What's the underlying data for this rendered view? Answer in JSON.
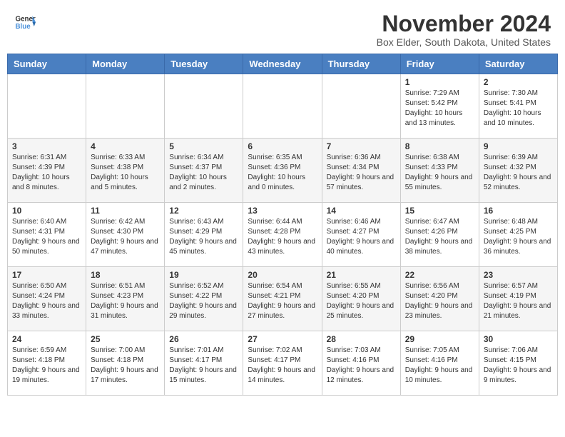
{
  "header": {
    "logo_line1": "General",
    "logo_line2": "Blue",
    "title": "November 2024",
    "subtitle": "Box Elder, South Dakota, United States"
  },
  "days_of_week": [
    "Sunday",
    "Monday",
    "Tuesday",
    "Wednesday",
    "Thursday",
    "Friday",
    "Saturday"
  ],
  "weeks": [
    [
      {
        "day": "",
        "info": ""
      },
      {
        "day": "",
        "info": ""
      },
      {
        "day": "",
        "info": ""
      },
      {
        "day": "",
        "info": ""
      },
      {
        "day": "",
        "info": ""
      },
      {
        "day": "1",
        "info": "Sunrise: 7:29 AM\nSunset: 5:42 PM\nDaylight: 10 hours and 13 minutes."
      },
      {
        "day": "2",
        "info": "Sunrise: 7:30 AM\nSunset: 5:41 PM\nDaylight: 10 hours and 10 minutes."
      }
    ],
    [
      {
        "day": "3",
        "info": "Sunrise: 6:31 AM\nSunset: 4:39 PM\nDaylight: 10 hours and 8 minutes."
      },
      {
        "day": "4",
        "info": "Sunrise: 6:33 AM\nSunset: 4:38 PM\nDaylight: 10 hours and 5 minutes."
      },
      {
        "day": "5",
        "info": "Sunrise: 6:34 AM\nSunset: 4:37 PM\nDaylight: 10 hours and 2 minutes."
      },
      {
        "day": "6",
        "info": "Sunrise: 6:35 AM\nSunset: 4:36 PM\nDaylight: 10 hours and 0 minutes."
      },
      {
        "day": "7",
        "info": "Sunrise: 6:36 AM\nSunset: 4:34 PM\nDaylight: 9 hours and 57 minutes."
      },
      {
        "day": "8",
        "info": "Sunrise: 6:38 AM\nSunset: 4:33 PM\nDaylight: 9 hours and 55 minutes."
      },
      {
        "day": "9",
        "info": "Sunrise: 6:39 AM\nSunset: 4:32 PM\nDaylight: 9 hours and 52 minutes."
      }
    ],
    [
      {
        "day": "10",
        "info": "Sunrise: 6:40 AM\nSunset: 4:31 PM\nDaylight: 9 hours and 50 minutes."
      },
      {
        "day": "11",
        "info": "Sunrise: 6:42 AM\nSunset: 4:30 PM\nDaylight: 9 hours and 47 minutes."
      },
      {
        "day": "12",
        "info": "Sunrise: 6:43 AM\nSunset: 4:29 PM\nDaylight: 9 hours and 45 minutes."
      },
      {
        "day": "13",
        "info": "Sunrise: 6:44 AM\nSunset: 4:28 PM\nDaylight: 9 hours and 43 minutes."
      },
      {
        "day": "14",
        "info": "Sunrise: 6:46 AM\nSunset: 4:27 PM\nDaylight: 9 hours and 40 minutes."
      },
      {
        "day": "15",
        "info": "Sunrise: 6:47 AM\nSunset: 4:26 PM\nDaylight: 9 hours and 38 minutes."
      },
      {
        "day": "16",
        "info": "Sunrise: 6:48 AM\nSunset: 4:25 PM\nDaylight: 9 hours and 36 minutes."
      }
    ],
    [
      {
        "day": "17",
        "info": "Sunrise: 6:50 AM\nSunset: 4:24 PM\nDaylight: 9 hours and 33 minutes."
      },
      {
        "day": "18",
        "info": "Sunrise: 6:51 AM\nSunset: 4:23 PM\nDaylight: 9 hours and 31 minutes."
      },
      {
        "day": "19",
        "info": "Sunrise: 6:52 AM\nSunset: 4:22 PM\nDaylight: 9 hours and 29 minutes."
      },
      {
        "day": "20",
        "info": "Sunrise: 6:54 AM\nSunset: 4:21 PM\nDaylight: 9 hours and 27 minutes."
      },
      {
        "day": "21",
        "info": "Sunrise: 6:55 AM\nSunset: 4:20 PM\nDaylight: 9 hours and 25 minutes."
      },
      {
        "day": "22",
        "info": "Sunrise: 6:56 AM\nSunset: 4:20 PM\nDaylight: 9 hours and 23 minutes."
      },
      {
        "day": "23",
        "info": "Sunrise: 6:57 AM\nSunset: 4:19 PM\nDaylight: 9 hours and 21 minutes."
      }
    ],
    [
      {
        "day": "24",
        "info": "Sunrise: 6:59 AM\nSunset: 4:18 PM\nDaylight: 9 hours and 19 minutes."
      },
      {
        "day": "25",
        "info": "Sunrise: 7:00 AM\nSunset: 4:18 PM\nDaylight: 9 hours and 17 minutes."
      },
      {
        "day": "26",
        "info": "Sunrise: 7:01 AM\nSunset: 4:17 PM\nDaylight: 9 hours and 15 minutes."
      },
      {
        "day": "27",
        "info": "Sunrise: 7:02 AM\nSunset: 4:17 PM\nDaylight: 9 hours and 14 minutes."
      },
      {
        "day": "28",
        "info": "Sunrise: 7:03 AM\nSunset: 4:16 PM\nDaylight: 9 hours and 12 minutes."
      },
      {
        "day": "29",
        "info": "Sunrise: 7:05 AM\nSunset: 4:16 PM\nDaylight: 9 hours and 10 minutes."
      },
      {
        "day": "30",
        "info": "Sunrise: 7:06 AM\nSunset: 4:15 PM\nDaylight: 9 hours and 9 minutes."
      }
    ]
  ]
}
